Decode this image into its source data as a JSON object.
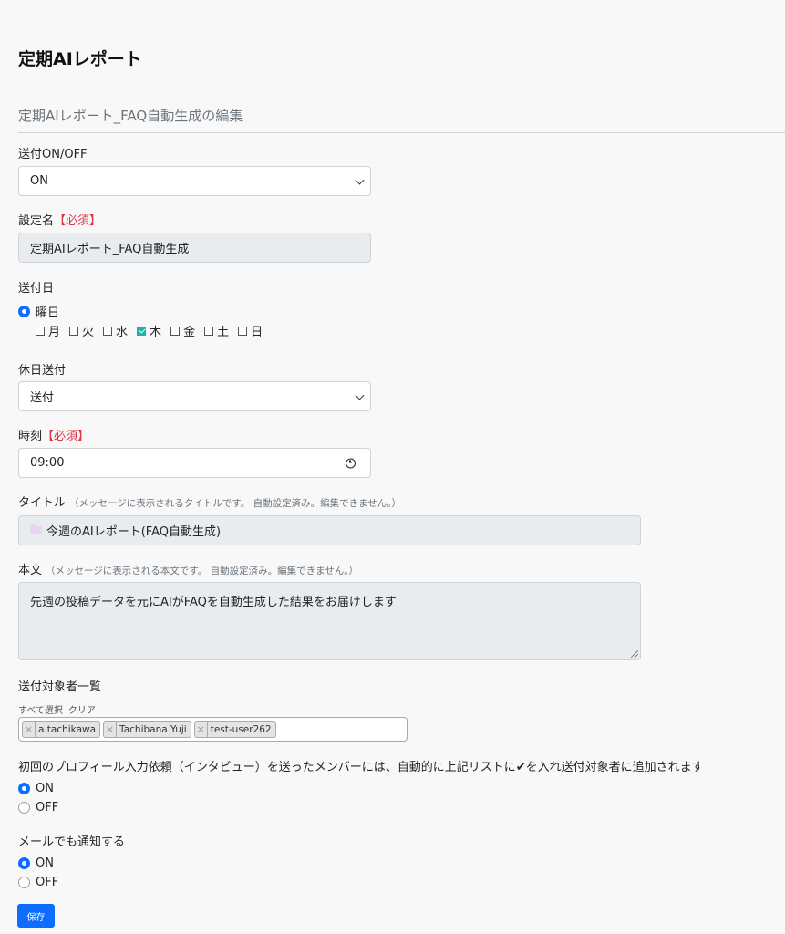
{
  "page": {
    "title": "定期AIレポート",
    "subtitle": "定期AIレポート_FAQ自動生成の編集"
  },
  "send_toggle": {
    "label": "送付ON/OFF",
    "value": "ON"
  },
  "setting_name": {
    "label": "設定名",
    "required": "【必須】",
    "value": "定期AIレポート_FAQ自動生成"
  },
  "send_day": {
    "label": "送付日",
    "option_label": "曜日",
    "days": [
      {
        "label": "月",
        "checked": false
      },
      {
        "label": "火",
        "checked": false
      },
      {
        "label": "水",
        "checked": false
      },
      {
        "label": "木",
        "checked": true
      },
      {
        "label": "金",
        "checked": false
      },
      {
        "label": "土",
        "checked": false
      },
      {
        "label": "日",
        "checked": false
      }
    ]
  },
  "holiday_send": {
    "label": "休日送付",
    "value": "送付"
  },
  "time": {
    "label": "時刻",
    "required": "【必須】",
    "value": "09:00"
  },
  "message_title": {
    "label": "タイトル",
    "hint": "（メッセージに表示されるタイトルです。 自動設定済み。編集できません。）",
    "value": "今週のAIレポート(FAQ自動生成)"
  },
  "message_body": {
    "label": "本文",
    "hint": "（メッセージに表示される本文です。 自動設定済み。編集できません。）",
    "value": "先週の投稿データを元にAIがFAQを自動生成した結果をお届けします"
  },
  "recipients": {
    "label": "送付対象者一覧",
    "select_all": "すべて選択",
    "clear": "クリア",
    "tags": [
      "a.tachikawa",
      "Tachibana Yuji",
      "test-user262"
    ]
  },
  "auto_add": {
    "label": "初回のプロフィール入力依頼（インタビュー）を送ったメンバーには、自動的に上記リストに✔を入れ送付対象者に追加されます",
    "on": "ON",
    "off": "OFF",
    "selected": "ON"
  },
  "email_notify": {
    "label": "メールでも通知する",
    "on": "ON",
    "off": "OFF",
    "selected": "ON"
  },
  "save_button": "保存",
  "colors": {
    "primary": "#0d6efd",
    "required": "#dc3545",
    "checked": "#20b2aa"
  }
}
